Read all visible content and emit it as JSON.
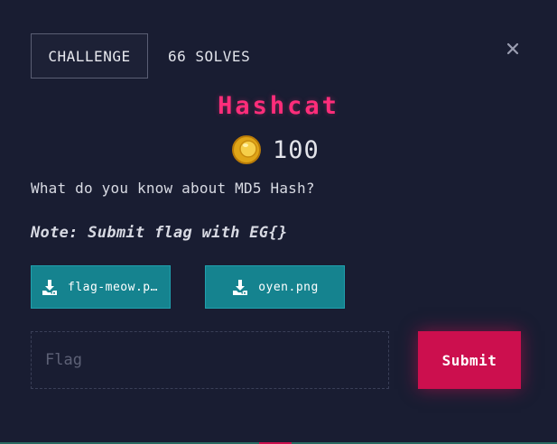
{
  "tabs": {
    "challenge_label": "CHALLENGE",
    "solves_label": "66 SOLVES"
  },
  "close": {
    "icon": "close-icon"
  },
  "challenge": {
    "title": "Hashcat",
    "points": "100",
    "coin_icon": "coin-icon",
    "description": "What do you know about MD5 Hash?",
    "note": "Note: Submit flag with EG{}"
  },
  "files": [
    {
      "name": "flag-meow.p…",
      "icon": "download-icon"
    },
    {
      "name": "oyen.png",
      "icon": "download-icon"
    }
  ],
  "form": {
    "flag_placeholder": "Flag",
    "flag_value": "",
    "submit_label": "Submit"
  },
  "colors": {
    "background": "#191d32",
    "title": "#ff2d7a",
    "file_button": "#15838f",
    "submit_button": "#cc0f4e"
  }
}
